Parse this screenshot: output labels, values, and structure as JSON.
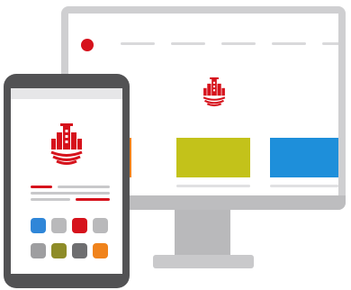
{
  "colors": {
    "brand_red": "#d6121c",
    "orange": "#f0831c",
    "olive": "#c3c21a",
    "blue": "#1e8fda",
    "monitor_frame": "#cfcfd1",
    "phone_frame": "#525254"
  },
  "icons": {
    "logo": "red-building-logo-icon",
    "indicator": "red-dot-icon"
  },
  "phone_swatches": [
    "#2f86d8",
    "#b9b9bb",
    "#d6121c",
    "#b9b9bb",
    "#9e9ea0",
    "#8e8c28",
    "#6e6e70",
    "#f0831c"
  ]
}
